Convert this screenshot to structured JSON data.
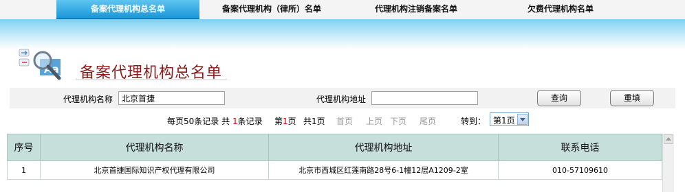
{
  "tabs": [
    {
      "label": "备案代理机构总名单",
      "active": true
    },
    {
      "label": "备案代理机构（律所）名单",
      "active": false
    },
    {
      "label": "代理机构注销备案名单",
      "active": false
    },
    {
      "label": "欠费代理机构名单",
      "active": false
    }
  ],
  "header": {
    "title": "备案代理机构总名单"
  },
  "search": {
    "name_label": "代理机构名称",
    "name_value": "北京首捷",
    "address_label": "代理机构地址",
    "address_value": "",
    "query_button": "查询",
    "reset_button": "重填"
  },
  "pager": {
    "per_page_prefix": "每页",
    "per_page": "50",
    "per_page_suffix": "条记录",
    "total_prefix": "共",
    "total": "1",
    "total_suffix": "条记录",
    "current_prefix": "第",
    "current": "1",
    "current_suffix": "页",
    "pages_prefix": "共",
    "pages": "1",
    "pages_suffix": "页",
    "first": "首页",
    "prev": "上页",
    "next": "下页",
    "last": "尾页",
    "goto_label": "转到：",
    "goto_value": "第1页"
  },
  "table": {
    "headers": [
      "序号",
      "代理机构名称",
      "代理机构地址",
      "联系电话"
    ],
    "rows": [
      [
        "1",
        "北京首捷国际知识产权代理有限公司",
        "北京市西城区红莲南路28号6-1幢12层A1209-2室",
        "010-57109610"
      ]
    ]
  },
  "colors": {
    "active_tab": "#1b98d8",
    "title": "#8b1a1a",
    "table_header": "#c7dfdb",
    "highlight": "#d40000"
  }
}
